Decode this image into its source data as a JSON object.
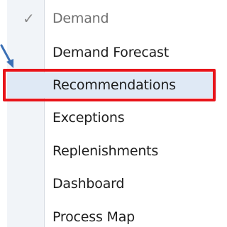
{
  "menu": {
    "items": [
      {
        "label": "Demand",
        "checked": true,
        "disabled": true
      },
      {
        "label": "Demand Forecast"
      },
      {
        "label": "Recommendations",
        "highlighted": true
      },
      {
        "label": "Exceptions"
      },
      {
        "label": "Replenishments"
      },
      {
        "label": "Dashboard"
      },
      {
        "label": "Process Map"
      }
    ],
    "check_glyph": "✓"
  },
  "colors": {
    "callout": "#e8141a",
    "arrow": "#3a6fb5",
    "highlight": "#dfe9f5"
  },
  "icons": {
    "check": "check-icon",
    "pointer": "pointer-arrow-icon"
  }
}
